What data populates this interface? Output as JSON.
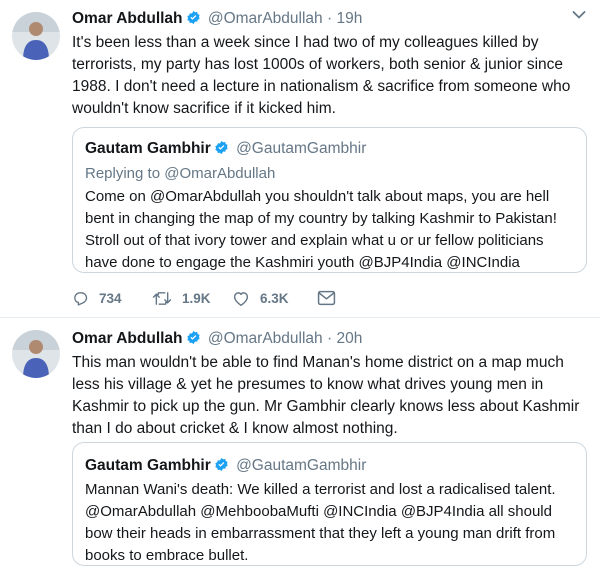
{
  "colors": {
    "verified": "#1da1f2",
    "text": "#14171a",
    "muted": "#657786",
    "border": "#ccd6dd"
  },
  "tweets": [
    {
      "author": "Omar Abdullah",
      "handle": "@OmarAbdullah",
      "separator": "·",
      "time": "19h",
      "text": "It's been less than a week since I had two of my colleagues killed by terrorists, my party has lost 1000s of workers, both senior & junior since 1988. I don't need a lecture in nationalism & sacrifice from someone who wouldn't know sacrifice if it kicked him.",
      "quote": {
        "author": "Gautam Gambhir",
        "handle": "@GautamGambhir",
        "replying_prefix": "Replying to ",
        "replying_to": "@OmarAbdullah",
        "text": "Come on @OmarAbdullah you shouldn't talk about maps, you are hell bent in changing the map of my country by talking Kashmir to Pakistan! Stroll out of that ivory tower and explain what u or ur fellow politicians have done to engage the Kashmiri youth @BJP4India @INCIndia"
      },
      "actions": {
        "replies": "734",
        "retweets": "1.9K",
        "likes": "6.3K"
      }
    },
    {
      "author": "Omar Abdullah",
      "handle": "@OmarAbdullah",
      "separator": "·",
      "time": "20h",
      "text": "This man wouldn't be able to find Manan's home district on a map much less his village & yet he presumes to know what drives young men in Kashmir to pick up the gun. Mr Gambhir clearly knows less about Kashmir than I do about cricket & I know almost nothing.",
      "quote": {
        "author": "Gautam Gambhir",
        "handle": "@GautamGambhir",
        "text": "Mannan Wani's death: We killed a terrorist and lost a radicalised talent. @OmarAbdullah @MehboobaMufti @INCIndia @BJP4India all should bow their heads in embarrassment that they left a young man drift from books to embrace bullet."
      }
    }
  ]
}
